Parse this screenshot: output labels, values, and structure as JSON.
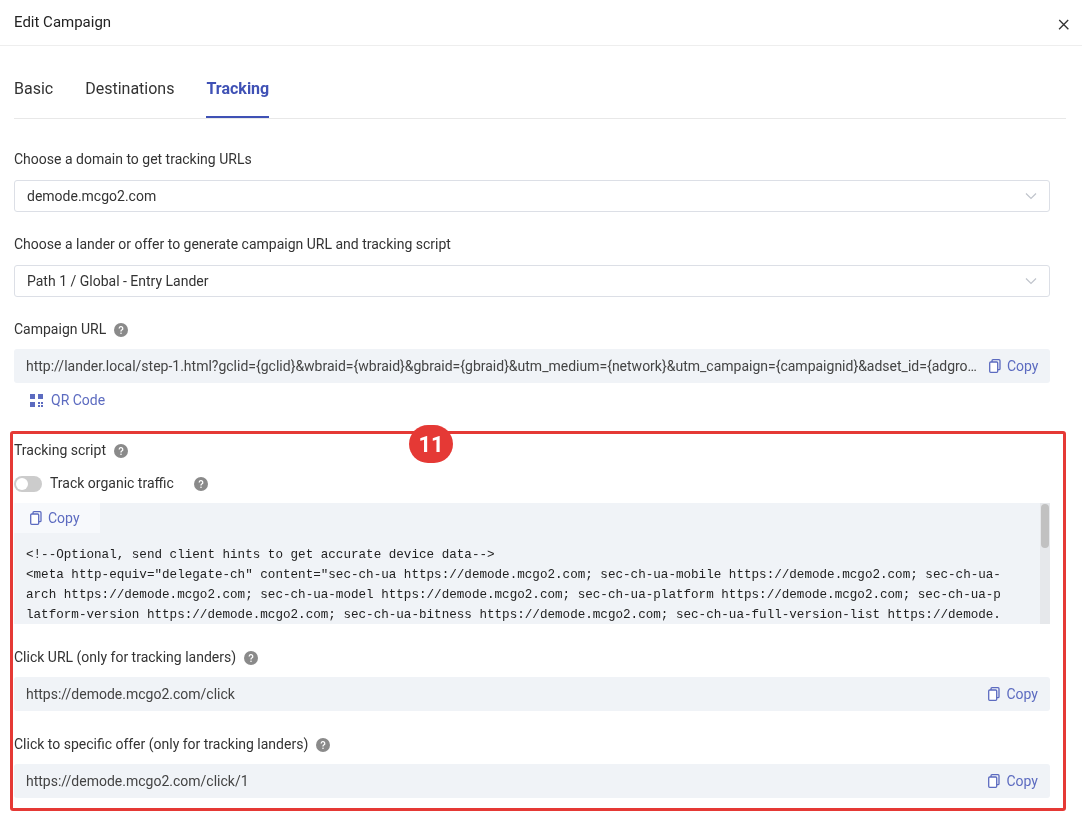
{
  "dialog": {
    "title": "Edit Campaign",
    "close": "×"
  },
  "tabs": [
    {
      "label": "Basic",
      "selected": false
    },
    {
      "label": "Destinations",
      "selected": false
    },
    {
      "label": "Tracking",
      "selected": true
    }
  ],
  "domain": {
    "label": "Choose a domain to get tracking URLs",
    "value": "demode.mcgo2.com"
  },
  "lander": {
    "label": "Choose a lander or offer to generate campaign URL and tracking script",
    "value": "Path 1 / Global - Entry Lander"
  },
  "campaign_url": {
    "label": "Campaign URL",
    "value": "http://lander.local/step-1.html?gclid={gclid}&wbraid={wbraid}&gbraid={gbraid}&utm_medium={network}&utm_campaign={campaignid}&adset_id={adgro…",
    "copy": "Copy",
    "qr": "QR Code"
  },
  "annotation": {
    "badge": "11"
  },
  "tracking_script": {
    "label": "Tracking script",
    "toggle": {
      "label": "Track organic traffic",
      "on": false
    },
    "copy": "Copy",
    "code_lines": [
      "<!--Optional, send client hints to get accurate device data-->",
      "<meta http-equiv=\"delegate-ch\" content=\"sec-ch-ua https://demode.mcgo2.com; sec-ch-ua-mobile https://demode.mcgo2.com; sec-ch-ua-",
      "arch https://demode.mcgo2.com; sec-ch-ua-model https://demode.mcgo2.com; sec-ch-ua-platform https://demode.mcgo2.com; sec-ch-ua-p",
      "latform-version https://demode.mcgo2.com; sec-ch-ua-bitness https://demode.mcgo2.com; sec-ch-ua-full-version-list https://demode."
    ]
  },
  "click_url": {
    "label": "Click URL (only for tracking landers)",
    "value": "https://demode.mcgo2.com/click",
    "copy": "Copy"
  },
  "click_offer": {
    "label": "Click to specific offer (only for tracking landers)",
    "value": "https://demode.mcgo2.com/click/1",
    "copy": "Copy"
  }
}
